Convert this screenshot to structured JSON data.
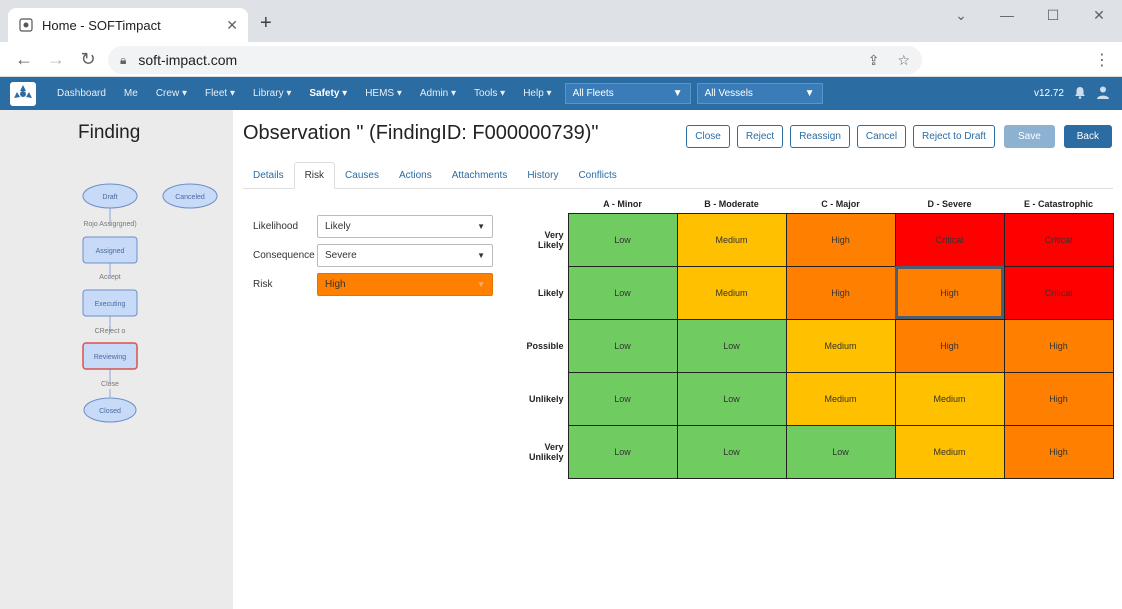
{
  "browser": {
    "tab_title": "Home - SOFTimpact",
    "url": "soft-impact.com"
  },
  "nav": {
    "items": [
      "Dashboard",
      "Me",
      "Crew ▾",
      "Fleet ▾",
      "Library ▾",
      "Safety ▾",
      "HEMS ▾",
      "Admin ▾",
      "Tools ▾",
      "Help ▾"
    ],
    "fleet_select": "All Fleets",
    "vessel_select": "All Vessels",
    "version": "v12.72"
  },
  "left": {
    "title": "Finding",
    "workflow": {
      "draft": "Draft",
      "canceled": "Canceled",
      "edge1": "Rojo Assigrgned)",
      "assigned": "Assigned",
      "edge2": "Accept",
      "executing": "Executing",
      "edge3": "CReject o",
      "reviewing": "Reviewing",
      "edge4": "Close",
      "closed": "Closed"
    }
  },
  "main": {
    "title": "Observation \" (FindingID: F000000739)\"",
    "buttons": {
      "close": "Close",
      "reject": "Reject",
      "reassign": "Reassign",
      "cancel": "Cancel",
      "reject_to_draft": "Reject to Draft",
      "save": "Save",
      "back": "Back"
    },
    "tabs": [
      "Details",
      "Risk",
      "Causes",
      "Actions",
      "Attachments",
      "History",
      "Conflicts"
    ],
    "form": {
      "likelihood_label": "Likelihood",
      "likelihood_value": "Likely",
      "consequence_label": "Consequence",
      "consequence_value": "Severe",
      "risk_label": "Risk",
      "risk_value": "High"
    },
    "matrix": {
      "columns": [
        "A - Minor",
        "B - Moderate",
        "C - Major",
        "D - Severe",
        "E - Catastrophic"
      ],
      "rows": [
        "Very Likely",
        "Likely",
        "Possible",
        "Unlikely",
        "Very Unlikely"
      ],
      "cells": [
        [
          "Low",
          "Medium",
          "High",
          "Critical",
          "Critical"
        ],
        [
          "Low",
          "Medium",
          "High",
          "High",
          "Critical"
        ],
        [
          "Low",
          "Low",
          "Medium",
          "High",
          "High"
        ],
        [
          "Low",
          "Low",
          "Medium",
          "Medium",
          "High"
        ],
        [
          "Low",
          "Low",
          "Low",
          "Medium",
          "High"
        ]
      ]
    }
  },
  "colors": {
    "low": "#70cc60",
    "medium": "#ffc000",
    "high": "#ff8000",
    "critical": "#ff0000",
    "brand": "#2b6ca3"
  }
}
